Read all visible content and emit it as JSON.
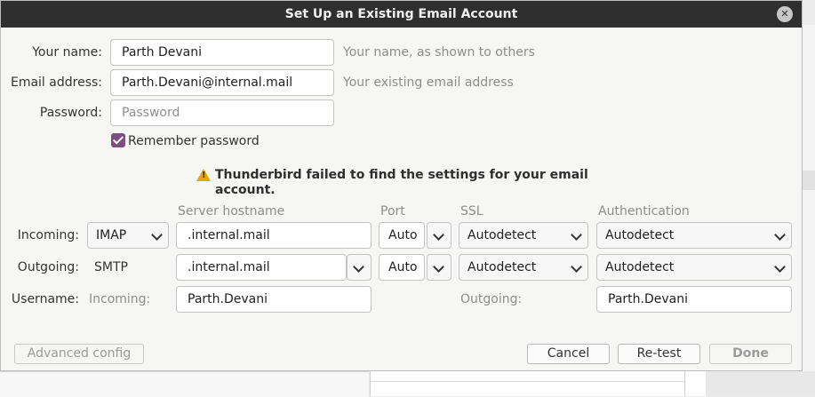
{
  "window": {
    "title": "Set Up an Existing Email Account",
    "close_glyph": "✕"
  },
  "identity": {
    "name_label": "Your name:",
    "name_value": "Parth Devani",
    "name_hint": "Your name, as shown to others",
    "email_label": "Email address:",
    "email_value": "Parth.Devani@internal.mail",
    "email_hint": "Your existing email address",
    "password_label": "Password:",
    "password_placeholder": "Password",
    "remember_label": "Remember password",
    "remember_checked": true
  },
  "warning": {
    "icon": "warning-icon",
    "text": "Thunderbird failed to find the settings for your email account."
  },
  "server": {
    "headers": {
      "hostname": "Server hostname",
      "port": "Port",
      "ssl": "SSL",
      "auth": "Authentication"
    },
    "incoming": {
      "label": "Incoming:",
      "protocol": "IMAP",
      "hostname": ".internal.mail",
      "port": "Auto",
      "ssl": "Autodetect",
      "auth": "Autodetect"
    },
    "outgoing": {
      "label": "Outgoing:",
      "protocol": "SMTP",
      "hostname": ".internal.mail",
      "port": "Auto",
      "ssl": "Autodetect",
      "auth": "Autodetect"
    },
    "username": {
      "label": "Username:",
      "incoming_label": "Incoming:",
      "incoming_value": "Parth.Devani",
      "outgoing_label": "Outgoing:",
      "outgoing_value": "Parth.Devani"
    }
  },
  "buttons": {
    "advanced": "Advanced config",
    "cancel": "Cancel",
    "retest": "Re-test",
    "done": "Done"
  },
  "colors": {
    "checkbox": "#7f4e80",
    "warning": "#e6a50a",
    "titlebar": "#2f2f2f"
  }
}
